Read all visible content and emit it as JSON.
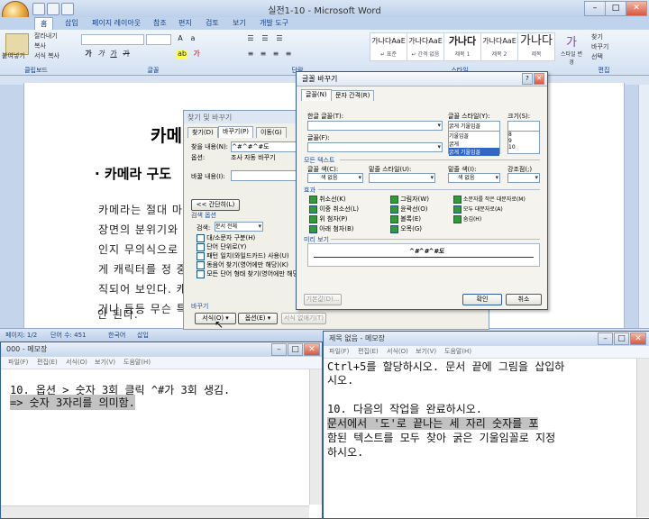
{
  "word": {
    "title": "실전1-10 - Microsoft Word",
    "tabs": [
      "홈",
      "삽입",
      "페이지 레이아웃",
      "참조",
      "편지",
      "검토",
      "보기",
      "개발 도구"
    ],
    "active_tab": "홈",
    "clipboard": {
      "paste": "붙여넣기",
      "cut": "잘라내기",
      "copy": "복사",
      "format_painter": "서식 복사"
    },
    "group_labels": {
      "clipboard": "클립보드",
      "font": "글꼴",
      "paragraph": "단락",
      "styles": "스타일",
      "editing": "편집"
    },
    "styles": [
      {
        "preview": "가나다AaE",
        "name": "↵ 표준"
      },
      {
        "preview": "가나다AaE",
        "name": "↵ 간격 없음"
      },
      {
        "preview": "가나다",
        "name": "제목 1"
      },
      {
        "preview": "가나다AaE",
        "name": "제목 2"
      },
      {
        "preview": "가나다",
        "name": "제목"
      }
    ],
    "change_styles": "스타일 변경",
    "editing": {
      "find": "찾기",
      "replace": "바꾸기",
      "select": "선택"
    },
    "document": {
      "title": "카메",
      "heading": "카메라 구도",
      "lines": [
        "카메라는 절대 마",
        "장면의 분위기와 ",
        "인지 무의식으로",
        "게 캐릭터를 정 중",
        "직되어 보인다. 캐",
        "거나 등등 무슨 특",
        "안 된다."
      ]
    },
    "status": {
      "page": "페이지: 1/2",
      "words": "단어 수: 451",
      "language": "한국어",
      "mode": "삽입"
    }
  },
  "find_dialog": {
    "title": "찾기 및 바꾸기",
    "tabs": [
      "찾기(D)",
      "바꾸기(P)",
      "이동(G)"
    ],
    "active_tab": "바꾸기(P)",
    "find_label": "찾을 내용(N):",
    "find_value": "^#^#^#도",
    "options_label": "옵션:",
    "options_value": "조사 자동 바꾸기",
    "replace_label": "바꿀 내용(I):",
    "less_button": "<< 간단히(L)",
    "search_options_title": "검색 옵션",
    "search_label": "검색:",
    "search_value": "문서 전체",
    "checkboxes": [
      "대/소문자 구분(H)",
      "단어 단위로(Y)",
      "패턴 일치(와일드카드) 사용(U)",
      "동음어 찾기(영어에만 해당)(K)",
      "모든 단어 형태 찾기(영어에만 해당)(W)"
    ],
    "replace_section": "바꾸기",
    "format_button": "서식(O) ▾",
    "special_button": "옵션(E) ▾",
    "no_format_button": "서식 없애기(T)"
  },
  "font_dialog": {
    "title": "글꼴 바꾸기",
    "tabs": [
      "글꼴(N)",
      "문자 간격(R)"
    ],
    "active_tab": "글꼴(N)",
    "hangul_font_label": "한글 글꼴(T):",
    "font_label": "글꼴(F):",
    "style_label": "글꼴 스타일(Y):",
    "style_value": "굵게 기울임꼴",
    "style_options": [
      "기울임꼴",
      "굵게",
      "굵게 기울임꼴"
    ],
    "size_label": "크기(S):",
    "size_options": [
      "8",
      "9",
      "10"
    ],
    "all_text": "모든 텍스트",
    "color_label": "글꼴 색(C):",
    "color_value": "색 없음",
    "underline_label": "밑줄 스타일(U):",
    "underline_color_label": "밑줄 색(I):",
    "underline_color_value": "색 없음",
    "emphasis_label": "강조점(;)",
    "effects_title": "효과",
    "effects_col1": [
      "취소선(K)",
      "이중 취소선(L)",
      "위 첨자(P)",
      "아래 첨자(B)"
    ],
    "effects_col2": [
      "그림자(W)",
      "윤곽선(O)",
      "볼록(E)",
      "오목(G)"
    ],
    "effects_col3": [
      "소문자를 작은 대문자로(M)",
      "모두 대문자로(A)",
      "숨김(H)"
    ],
    "preview_title": "미리 보기",
    "preview_text": "^#^#^#도",
    "default_button": "기본값(D)...",
    "ok_button": "확인",
    "cancel_button": "취소"
  },
  "notepad_left": {
    "title": "000 - 메모장",
    "menu": [
      "파일(F)",
      "편집(E)",
      "서식(O)",
      "보기(V)",
      "도움말(H)"
    ],
    "lines": [
      "10. 옵션 > 숫자 3회 클릭 ^#가 3회 생김.",
      " => 숫자 3자리를 의미함."
    ]
  },
  "notepad_right": {
    "title": "제목 없음 - 메모장",
    "menu": [
      "파일(F)",
      "편집(E)",
      "서식(O)",
      "보기(V)",
      "도움말(H)"
    ],
    "lines": [
      "Ctrl+5를 할당하시오. 문서 끝에 그림을 삽입하",
      "시오.",
      "",
      "10. 다음의 작업을 완료하시오.",
      " 문서에서 '도'로 끝나는 세 자리 숫자를 포",
      "함된 텍스트를 모두 찾아 굵은 기울임꼴로 지정",
      "하시오."
    ]
  }
}
